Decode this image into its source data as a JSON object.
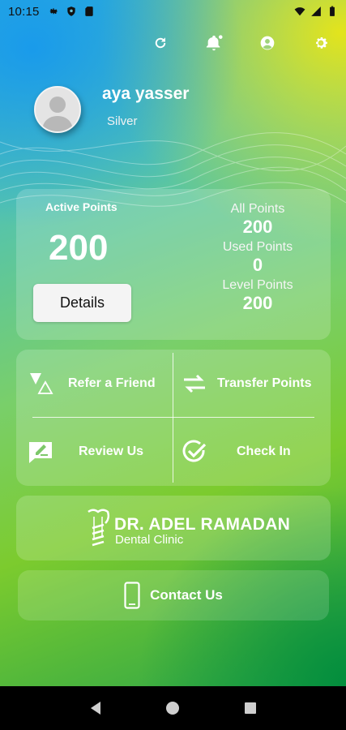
{
  "status_bar": {
    "time": "10:15",
    "left_icons": [
      "gear-icon",
      "shield-icon",
      "sd-card-icon"
    ],
    "right_icons": [
      "wifi-icon",
      "signal-icon",
      "battery-icon"
    ]
  },
  "top_actions": [
    "refresh-icon",
    "bell-icon",
    "account-icon",
    "settings-icon"
  ],
  "profile": {
    "name": "aya yasser",
    "tier": "Silver"
  },
  "points": {
    "active_label": "Active Points",
    "active_value": "200",
    "details_label": "Details",
    "all_label": "All Points",
    "all_value": "200",
    "used_label": "Used Points",
    "used_value": "0",
    "level_label": "Level Points",
    "level_value": "200"
  },
  "actions": {
    "refer": "Refer a Friend",
    "transfer": "Transfer Points",
    "review": "Review Us",
    "checkin": "Check In"
  },
  "clinic": {
    "name": "DR. ADEL RAMADAN",
    "subtitle": "Dental Clinic"
  },
  "contact": {
    "label": "Contact Us"
  },
  "nav": [
    "back-icon",
    "home-icon",
    "recents-icon"
  ]
}
